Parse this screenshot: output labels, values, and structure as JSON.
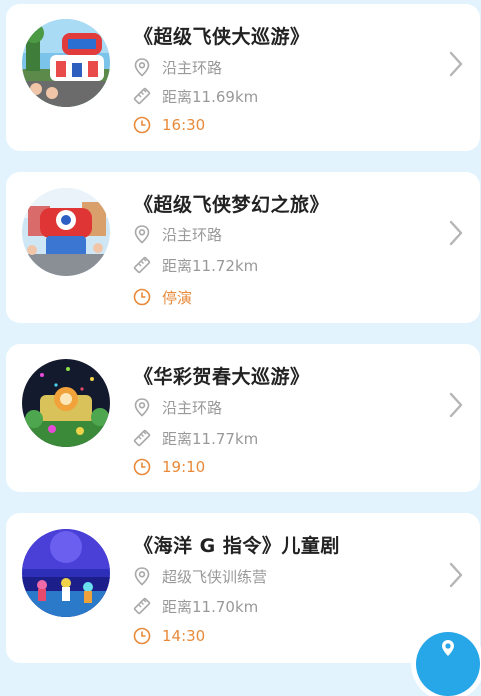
{
  "shows": [
    {
      "title": "《超级飞侠大巡游》",
      "location": "沿主环路",
      "distance": "距离11.69km",
      "time": "16:30"
    },
    {
      "title": "《超级飞侠梦幻之旅》",
      "location": "沿主环路",
      "distance": "距离11.72km",
      "time": "停演"
    },
    {
      "title": "《华彩贺春大巡游》",
      "location": "沿主环路",
      "distance": "距离11.77km",
      "time": "19:10"
    },
    {
      "title": "《海洋 G 指令》儿童剧",
      "location": "超级飞侠训练营",
      "distance": "距离11.70km",
      "time": "14:30"
    }
  ],
  "icons": {
    "location": "map-pin-icon",
    "distance": "ruler-icon",
    "time": "clock-icon",
    "arrow": "chevron-right-icon",
    "fab": "navigation-icon"
  },
  "colors": {
    "page_background": "#e3f3fd",
    "card_background": "#ffffff",
    "title": "#222222",
    "meta_text": "#999999",
    "time_text": "#e88a3a",
    "fab": "#27a6e8"
  }
}
